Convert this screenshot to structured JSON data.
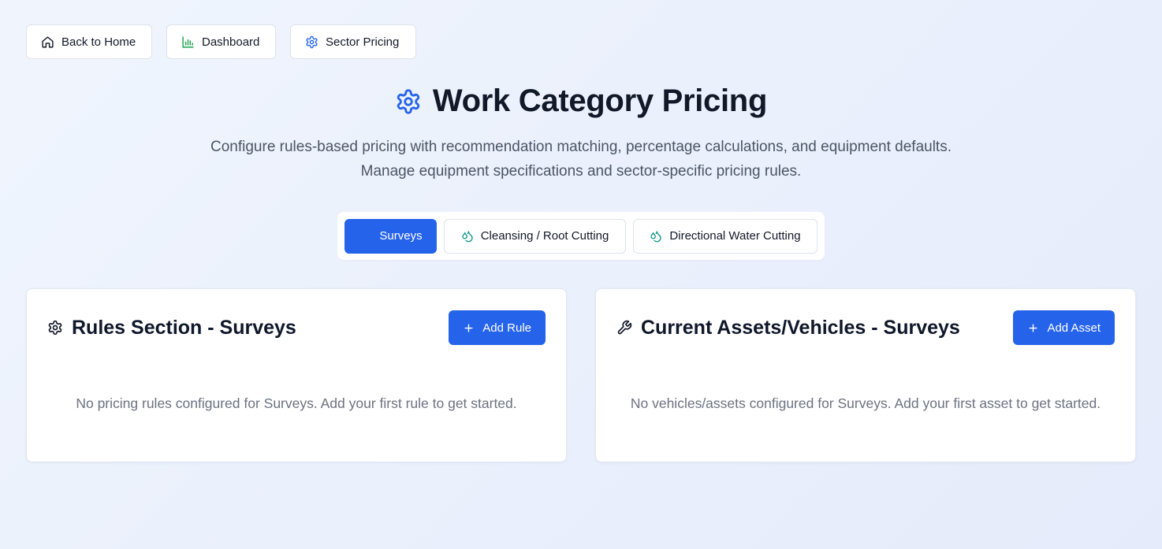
{
  "nav": {
    "home_label": "Back to Home",
    "dashboard_label": "Dashboard",
    "sector_label": "Sector Pricing"
  },
  "header": {
    "title": "Work Category Pricing",
    "subtitle_line1": "Configure rules-based pricing with recommendation matching, percentage calculations, and equipment defaults.",
    "subtitle_line2": "Manage equipment specifications and sector-specific pricing rules."
  },
  "tabs": [
    {
      "label": "Surveys",
      "active": true
    },
    {
      "label": "Cleansing / Root Cutting",
      "active": false
    },
    {
      "label": "Directional Water Cutting",
      "active": false
    }
  ],
  "rules": {
    "title": "Rules Section - Surveys",
    "button": "Add Rule",
    "empty": "No pricing rules configured for Surveys. Add your first rule to get started."
  },
  "assets": {
    "title": "Current Assets/Vehicles - Surveys",
    "button": "Add Asset",
    "empty": "No vehicles/assets configured for Surveys. Add your first asset to get started."
  },
  "icons": {
    "home": "home-icon",
    "dashboard": "bar-chart-icon",
    "sector": "gear-icon",
    "title": "gear-icon",
    "tab_water": "droplets-icon",
    "rules": "gear-icon",
    "assets": "wrench-icon",
    "add": "plus-icon"
  },
  "colors": {
    "primary": "#2563eb",
    "chart_green": "#16a34a",
    "water_teal": "#0d9488",
    "text_muted": "#6b7280"
  }
}
